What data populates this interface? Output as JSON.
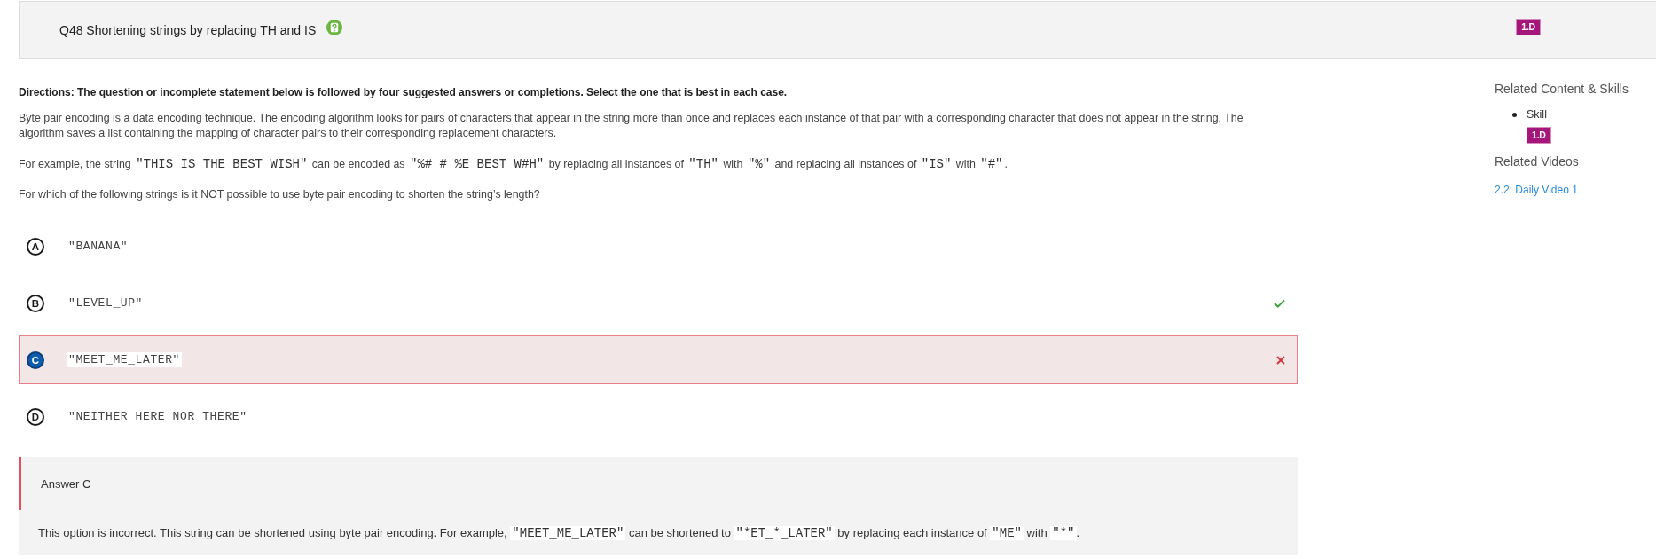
{
  "header": {
    "title": "Q48 Shortening strings by replacing TH and IS",
    "skill_badge": "1.D"
  },
  "directions": "Directions: The question or incomplete statement below is followed by four suggested answers or completions. Select the one that is best in each case.",
  "stem": [
    [
      {
        "kind": "text",
        "text": "Byte pair encoding is a data encoding technique. The encoding algorithm looks for pairs of characters that appear in the string more than once and replaces each instance of that pair with a corresponding character that does not appear in the string. The algorithm saves a list containing the mapping of character pairs to their corresponding replacement characters."
      }
    ],
    [
      {
        "kind": "text",
        "text": "For example, the string "
      },
      {
        "kind": "code",
        "text": "\"THIS_IS_THE_BEST_WISH\""
      },
      {
        "kind": "text",
        "text": " can be encoded as "
      },
      {
        "kind": "code",
        "text": "\"%#_#_%E_BEST_W#H\""
      },
      {
        "kind": "text",
        "text": " by replacing all instances of "
      },
      {
        "kind": "code",
        "text": "\"TH\""
      },
      {
        "kind": "text",
        "text": " with "
      },
      {
        "kind": "code",
        "text": "\"%\""
      },
      {
        "kind": "text",
        "text": " and replacing all instances of "
      },
      {
        "kind": "code",
        "text": "\"IS\""
      },
      {
        "kind": "text",
        "text": " with "
      },
      {
        "kind": "code",
        "text": "\"#\""
      },
      {
        "kind": "text",
        "text": "."
      }
    ],
    [
      {
        "kind": "text",
        "text": "For which of the following strings is it NOT possible to use byte pair encoding to shorten the string’s length?"
      }
    ]
  ],
  "options": [
    {
      "letter": "A",
      "text": "\"BANANA\"",
      "selected": false,
      "correct": false
    },
    {
      "letter": "B",
      "text": "\"LEVEL_UP\"",
      "selected": false,
      "correct": true
    },
    {
      "letter": "C",
      "text": "\"MEET_ME_LATER\"",
      "selected": true,
      "correct": false
    },
    {
      "letter": "D",
      "text": "\"NEITHER_HERE_NOR_THERE\"",
      "selected": false,
      "correct": false
    }
  ],
  "answer": {
    "heading": "Answer C",
    "explanation": [
      {
        "kind": "text",
        "text": "This option is incorrect. This string can be shortened using byte pair encoding. For example, "
      },
      {
        "kind": "code",
        "text": "\"MEET_ME_LATER\""
      },
      {
        "kind": "text",
        "text": " can be shortened to "
      },
      {
        "kind": "code",
        "text": "\"*ET_*_LATER\""
      },
      {
        "kind": "text",
        "text": " by replacing each instance of "
      },
      {
        "kind": "code",
        "text": "\"ME\""
      },
      {
        "kind": "text",
        "text": " with "
      },
      {
        "kind": "code",
        "text": "\"*\""
      },
      {
        "kind": "text",
        "text": "."
      }
    ]
  },
  "sidebar": {
    "heading": "Related Content & Skills",
    "skills": [
      {
        "label": "Skill",
        "badge": "1.D"
      }
    ],
    "videos_heading": "Related Videos",
    "videos": [
      {
        "title": "2.2: Daily Video 1"
      }
    ]
  }
}
